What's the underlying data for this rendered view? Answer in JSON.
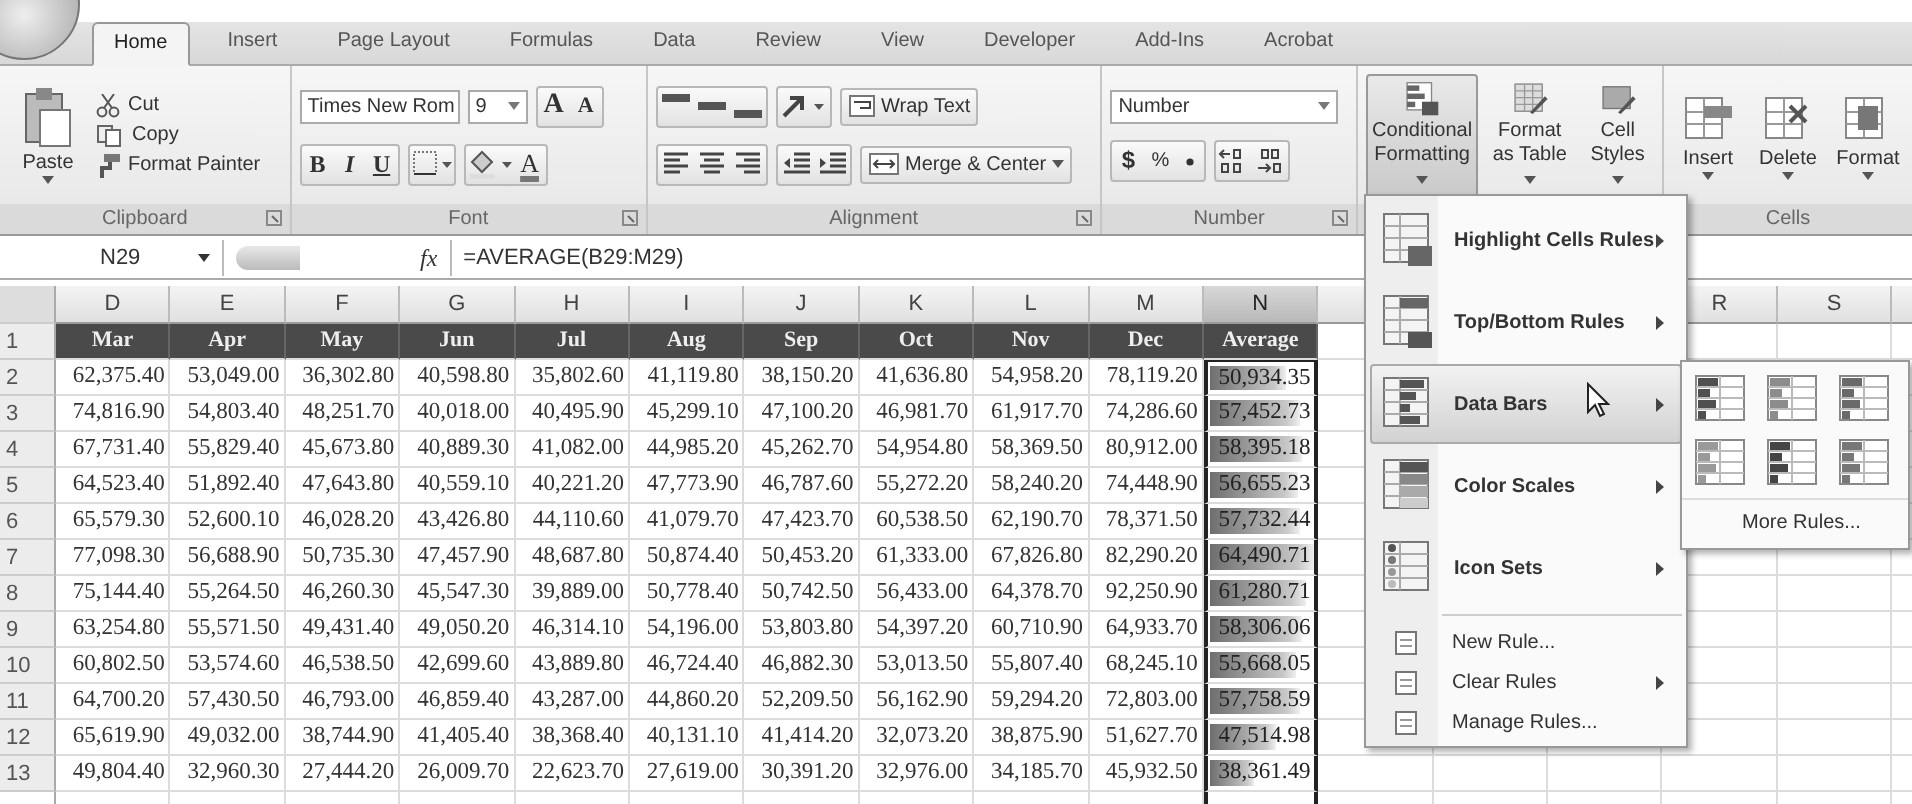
{
  "tabs": [
    {
      "label": "Home",
      "selected": true
    },
    {
      "label": "Insert",
      "selected": false
    },
    {
      "label": "Page Layout",
      "selected": false
    },
    {
      "label": "Formulas",
      "selected": false
    },
    {
      "label": "Data",
      "selected": false
    },
    {
      "label": "Review",
      "selected": false
    },
    {
      "label": "View",
      "selected": false
    },
    {
      "label": "Developer",
      "selected": false
    },
    {
      "label": "Add-Ins",
      "selected": false
    },
    {
      "label": "Acrobat",
      "selected": false
    }
  ],
  "ribbon": {
    "clipboard": {
      "label": "Clipboard",
      "paste": "Paste",
      "cut": "Cut",
      "copy": "Copy",
      "format_painter": "Format Painter"
    },
    "font": {
      "label": "Font",
      "family": "Times New Rom",
      "size": "9",
      "grow": "A",
      "shrink": "A",
      "bold": "B",
      "italic": "I",
      "underline": "U",
      "font_color": "A"
    },
    "alignment": {
      "label": "Alignment",
      "wrap": "Wrap Text",
      "merge": "Merge & Center"
    },
    "number": {
      "label": "Number",
      "format": "Number",
      "currency": "$",
      "percent": "%"
    },
    "styles": [
      {
        "label": "Conditional Formatting",
        "pressed": true
      },
      {
        "label": "Format as Table",
        "pressed": false
      },
      {
        "label": "Cell Styles",
        "pressed": false
      }
    ],
    "cells": {
      "label": "Cells",
      "buttons": [
        "Insert",
        "Delete",
        "Format"
      ]
    }
  },
  "formula_bar": {
    "name_box": "N29",
    "fx": "fx",
    "formula": "=AVERAGE(B29:M29)"
  },
  "sheet": {
    "columns": [
      {
        "letter": "D",
        "selected": false
      },
      {
        "letter": "E",
        "selected": false
      },
      {
        "letter": "F",
        "selected": false
      },
      {
        "letter": "G",
        "selected": false
      },
      {
        "letter": "H",
        "selected": false
      },
      {
        "letter": "I",
        "selected": false
      },
      {
        "letter": "J",
        "selected": false
      },
      {
        "letter": "K",
        "selected": false
      },
      {
        "letter": "L",
        "selected": false
      },
      {
        "letter": "M",
        "selected": false
      },
      {
        "letter": "N",
        "selected": true
      }
    ],
    "right_columns": [
      {
        "letter": "R",
        "selected": false
      },
      {
        "letter": "S",
        "selected": false
      }
    ],
    "header_row": {
      "number": "1",
      "cells": [
        "Mar",
        "Apr",
        "May",
        "Jun",
        "Jul",
        "Aug",
        "Sep",
        "Oct",
        "Nov",
        "Dec",
        "Average"
      ]
    },
    "rows": [
      {
        "number": "2",
        "values": [
          "62,375.40",
          "53,049.00",
          "36,302.80",
          "40,598.80",
          "35,802.60",
          "41,119.80",
          "38,150.20",
          "41,636.80",
          "54,958.20",
          "78,119.20"
        ],
        "average": "50,934.35",
        "level": 0.72
      },
      {
        "number": "3",
        "values": [
          "74,816.90",
          "54,803.40",
          "48,251.70",
          "40,018.00",
          "40,495.90",
          "45,299.10",
          "47,100.20",
          "46,981.70",
          "61,917.70",
          "74,286.60"
        ],
        "average": "57,452.73",
        "level": 0.84
      },
      {
        "number": "4",
        "values": [
          "67,731.40",
          "55,829.40",
          "45,673.80",
          "40,889.30",
          "41,082.00",
          "44,985.20",
          "45,262.70",
          "54,954.80",
          "58,369.50",
          "80,912.00"
        ],
        "average": "58,395.18",
        "level": 0.86
      },
      {
        "number": "5",
        "values": [
          "64,523.40",
          "51,892.40",
          "47,643.80",
          "40,559.10",
          "40,221.20",
          "47,773.90",
          "46,787.60",
          "55,272.20",
          "58,240.20",
          "74,448.90"
        ],
        "average": "56,655.23",
        "level": 0.82
      },
      {
        "number": "6",
        "values": [
          "65,579.30",
          "52,600.10",
          "46,028.20",
          "43,426.80",
          "44,110.60",
          "41,079.70",
          "47,423.70",
          "60,538.50",
          "62,190.70",
          "78,371.50"
        ],
        "average": "57,732.44",
        "level": 0.85
      },
      {
        "number": "7",
        "values": [
          "77,098.30",
          "56,688.90",
          "50,735.30",
          "47,457.90",
          "48,687.80",
          "50,874.40",
          "50,453.20",
          "61,333.00",
          "67,826.80",
          "82,290.20"
        ],
        "average": "64,490.71",
        "level": 0.97
      },
      {
        "number": "8",
        "values": [
          "75,144.40",
          "55,264.50",
          "46,260.30",
          "45,547.30",
          "39,889.00",
          "50,778.40",
          "50,742.50",
          "56,433.00",
          "64,378.70",
          "92,250.90"
        ],
        "average": "61,280.71",
        "level": 0.91
      },
      {
        "number": "9",
        "values": [
          "63,254.80",
          "55,571.50",
          "49,431.40",
          "49,050.20",
          "46,314.10",
          "54,196.00",
          "53,803.80",
          "54,397.20",
          "60,710.90",
          "64,933.70"
        ],
        "average": "58,306.06",
        "level": 0.86
      },
      {
        "number": "10",
        "values": [
          "60,802.50",
          "53,574.60",
          "46,538.50",
          "42,699.60",
          "43,889.80",
          "46,724.40",
          "46,882.30",
          "53,013.50",
          "55,807.40",
          "68,245.10"
        ],
        "average": "55,668.05",
        "level": 0.8
      },
      {
        "number": "11",
        "values": [
          "64,700.20",
          "57,430.50",
          "46,793.00",
          "46,859.40",
          "43,287.00",
          "44,860.20",
          "52,209.50",
          "56,162.90",
          "59,294.20",
          "72,803.00"
        ],
        "average": "57,758.59",
        "level": 0.85
      },
      {
        "number": "12",
        "values": [
          "65,619.90",
          "49,032.00",
          "38,744.90",
          "41,405.40",
          "38,368.40",
          "40,131.10",
          "41,414.20",
          "32,073.20",
          "38,875.90",
          "51,627.70"
        ],
        "average": "47,514.98",
        "level": 0.62
      },
      {
        "number": "13",
        "values": [
          "49,804.40",
          "32,960.30",
          "27,444.20",
          "26,009.70",
          "22,623.70",
          "27,619.00",
          "30,391.20",
          "32,976.00",
          "34,185.70",
          "45,932.50"
        ],
        "average": "38,361.49",
        "level": 0.42
      }
    ]
  },
  "menu": {
    "items": [
      {
        "kind": "big",
        "label": "Highlight Cells Rules",
        "submenu": true,
        "selected": false
      },
      {
        "kind": "big",
        "label": "Top/Bottom Rules",
        "submenu": true,
        "selected": false
      },
      {
        "kind": "big",
        "label": "Data Bars",
        "submenu": true,
        "selected": true
      },
      {
        "kind": "big",
        "label": "Color Scales",
        "submenu": true,
        "selected": false
      },
      {
        "kind": "big",
        "label": "Icon Sets",
        "submenu": true,
        "selected": false
      },
      {
        "kind": "small",
        "label": "New Rule...",
        "submenu": false,
        "selected": false
      },
      {
        "kind": "small",
        "label": "Clear Rules",
        "submenu": true,
        "selected": false
      },
      {
        "kind": "small",
        "label": "Manage Rules...",
        "submenu": false,
        "selected": false
      }
    ]
  },
  "submenu": {
    "bars": [
      {
        "color": "#505050"
      },
      {
        "color": "#8c8c8c"
      },
      {
        "color": "#6a6a6a"
      },
      {
        "color": "#9a9a9a"
      },
      {
        "color": "#454545"
      },
      {
        "color": "#777777"
      }
    ],
    "more": "More Rules..."
  }
}
